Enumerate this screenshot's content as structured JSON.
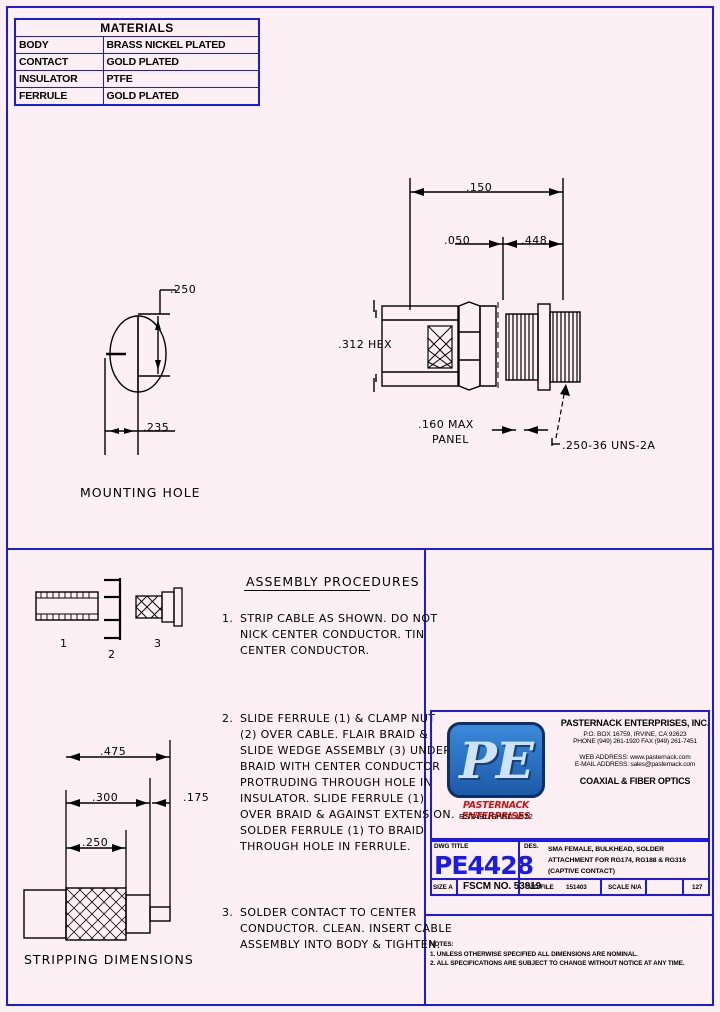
{
  "materials": {
    "title": "MATERIALS",
    "rows": [
      {
        "part": "BODY",
        "spec": "BRASS NICKEL PLATED"
      },
      {
        "part": "CONTACT",
        "spec": "GOLD PLATED"
      },
      {
        "part": "INSULATOR",
        "spec": "PTFE"
      },
      {
        "part": "FERRULE",
        "spec": "GOLD PLATED"
      }
    ]
  },
  "mounting_hole": {
    "caption": "MOUNTING HOLE",
    "dim_vertical": ".250",
    "dim_horizontal": ".235"
  },
  "connector_view": {
    "dim_overall": ".150",
    "dim_left": ".050",
    "dim_right": ".448",
    "dim_hex": ".312 HEX",
    "panel_note_line1": ".160 MAX",
    "panel_note_line2": "PANEL",
    "thread_callout": ".250-36 UNS-2A"
  },
  "assembly": {
    "heading": "ASSEMBLY PROCEDURES",
    "part_labels": [
      "1",
      "2",
      "3"
    ],
    "steps": [
      {
        "num": "1.",
        "lines": [
          "STRIP CABLE AS SHOWN. DO NOT",
          "NICK CENTER CONDUCTOR. TIN",
          "CENTER CONDUCTOR."
        ]
      },
      {
        "num": "2.",
        "lines": [
          "SLIDE FERRULE (1) & CLAMP NUT",
          "(2) OVER CABLE. FLAIR BRAID &",
          "SLIDE WEDGE ASSEMBLY (3) UNDER",
          "BRAID WITH CENTER CONDUCTOR",
          "PROTRUDING THROUGH HOLE IN",
          "INSULATOR. SLIDE FERRULE (1)",
          "OVER BRAID & AGAINST EXTENSION.",
          "SOLDER FERRULE (1) TO BRAID",
          "THROUGH HOLE IN FERRULE."
        ]
      },
      {
        "num": "3.",
        "lines": [
          "SOLDER CONTACT TO CENTER",
          "CONDUCTOR. CLEAN. INSERT CABLE",
          "ASSEMBLY INTO BODY & TIGHTEN."
        ]
      }
    ]
  },
  "stripping": {
    "caption": "STRIPPING DIMENSIONS",
    "dims": [
      ".475",
      ".300",
      ".250",
      ".175"
    ]
  },
  "company": {
    "logo_letters": "PE",
    "logo_name": "PASTERNACK ENTERPRISES",
    "logo_est": "ESTABLISHED 1972",
    "name": "PASTERNACK ENTERPRISES, INC.",
    "address": "P.O. BOX 16759, IRVINE, CA 92623",
    "phone": "PHONE (949) 261-1920 FAX (949) 261-7451",
    "web": "WEB ADDRESS: www.pasternack.com",
    "email": "E-MAIL ADDRESS: sales@pasternack.com",
    "tagline": "COAXIAL & FIBER OPTICS"
  },
  "title_block": {
    "dwg_title_label": "DWG TITLE",
    "part_number": "PE4428",
    "des_label": "DES.",
    "description_lines": [
      "SMA FEMALE, BULKHEAD, SOLDER",
      "ATTACHMENT FOR RG174, RG188 & RG316",
      "(CAPTIVE CONTACT)"
    ],
    "size_label": "SIZE A",
    "fscm": "FSCM NO.  53919",
    "cad_file_label": "CAD FILE",
    "cad_file_value": "151403",
    "scale": "SCALE N/A",
    "sheet": "127"
  },
  "notes": {
    "heading": "NOTES:",
    "items": [
      "1. UNLESS OTHERWISE SPECIFIED ALL DIMENSIONS ARE NOMINAL.",
      "2. ALL SPECIFICATIONS ARE SUBJECT TO CHANGE WITHOUT NOTICE AT ANY TIME."
    ]
  },
  "colors": {
    "border_blue": "#1a1aee",
    "page_bg": "#fdf0f5",
    "part_number_blue": "#1a1aee",
    "logo_red": "#d21010"
  }
}
